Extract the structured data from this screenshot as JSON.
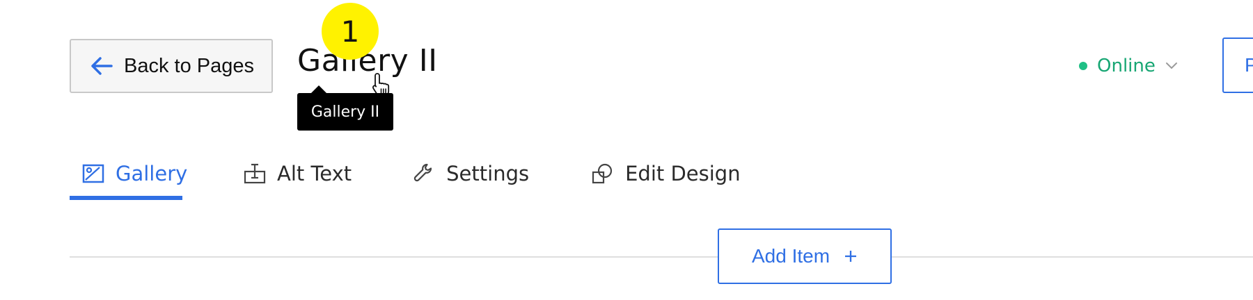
{
  "header": {
    "back_label": "Back to Pages",
    "title": "Gallery II",
    "step_number": "1",
    "tooltip": "Gallery II",
    "status": "Online",
    "right_button_label": "P"
  },
  "tabs": [
    {
      "label": "Gallery",
      "icon": "image-icon",
      "active": true
    },
    {
      "label": "Alt Text",
      "icon": "text-cursor-icon",
      "active": false
    },
    {
      "label": "Settings",
      "icon": "wrench-icon",
      "active": false
    },
    {
      "label": "Edit Design",
      "icon": "shapes-icon",
      "active": false
    }
  ],
  "content": {
    "add_item_label": "Add Item"
  },
  "colors": {
    "accent": "#2f6fe4",
    "online": "#17a673",
    "badge": "#fff200"
  }
}
